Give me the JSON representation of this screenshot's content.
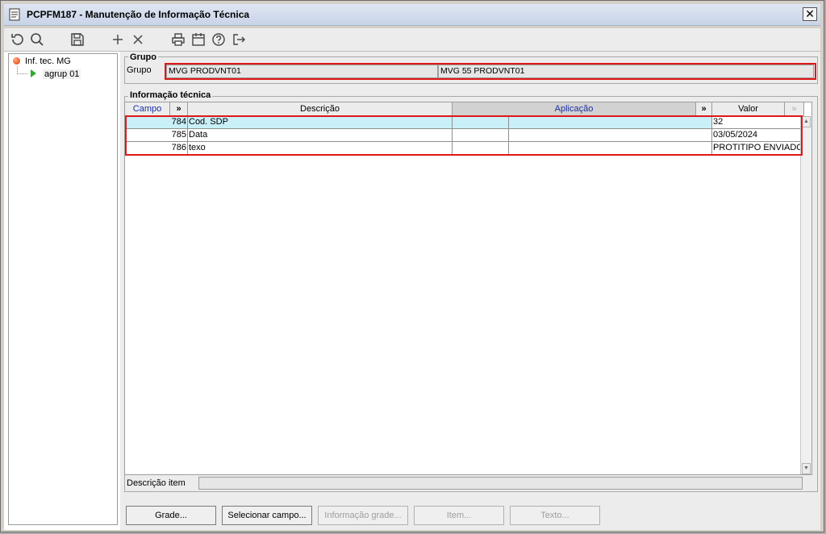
{
  "window": {
    "title": "PCPFM187 - Manutenção de Informação Técnica",
    "close_glyph": "✕"
  },
  "toolbar": [
    "refresh-icon",
    "search-icon",
    "save-icon",
    "add-icon",
    "delete-icon",
    "print-icon",
    "calendar-icon",
    "help-icon",
    "exit-icon"
  ],
  "tree": {
    "root": {
      "label": "Inf. tec. MG",
      "icon": "red-bullet-icon"
    },
    "child": {
      "label": "agrup 01",
      "icon": "play-triangle-icon"
    }
  },
  "grupo": {
    "legend": "Grupo",
    "label": "Grupo",
    "code": "MVG PRODVNT01",
    "description": "MVG 55 PRODVNT01"
  },
  "info": {
    "legend": "Informação técnica",
    "columns": {
      "campo": "Campo",
      "expand1": "»",
      "descricao": "Descrição",
      "aplicacao": "Aplicação",
      "expand2": "»",
      "valor": "Valor",
      "expand3": "»"
    },
    "rows": [
      {
        "campo": "784",
        "descricao": "Cod. SDP",
        "aplicacao": "",
        "valor": "32"
      },
      {
        "campo": "785",
        "descricao": "Data",
        "aplicacao": "",
        "valor": "03/05/2024"
      },
      {
        "campo": "786",
        "descricao": "texo",
        "aplicacao": "",
        "valor": "PROTITIPO ENVIADO P"
      }
    ]
  },
  "descricao_item": {
    "label": "Descrição item",
    "value": ""
  },
  "buttons": {
    "grade": "Grade...",
    "selecionar_campo": "Selecionar campo...",
    "informacao_grade": "Informação grade...",
    "item": "Item...",
    "texto": "Texto..."
  },
  "colors": {
    "highlight": "#e01818",
    "selected_row": "#c9f0f8",
    "header_blue": "#1a2fa0"
  }
}
